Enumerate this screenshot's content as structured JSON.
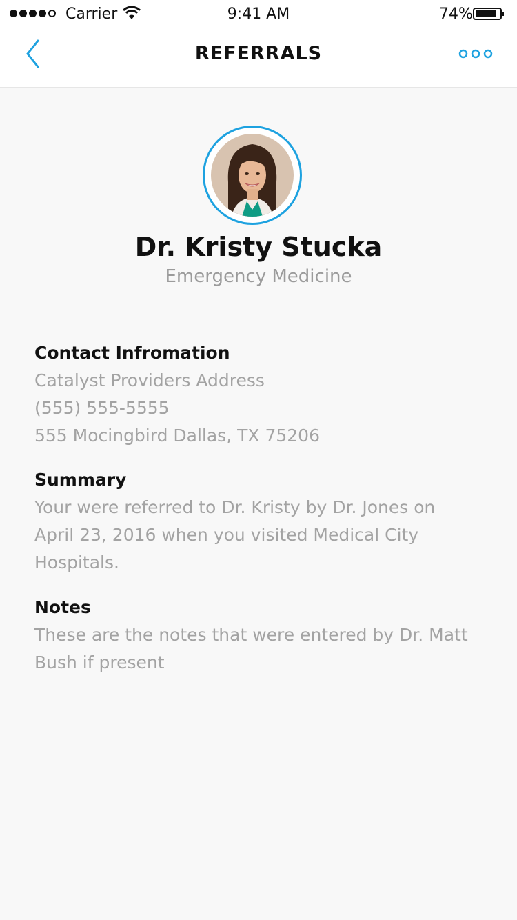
{
  "status_bar": {
    "carrier": "Carrier",
    "time": "9:41 AM",
    "battery": "74%",
    "signal_icon": "signal-dots-icon",
    "wifi_icon": "wifi-icon",
    "battery_icon": "battery-icon"
  },
  "nav": {
    "title": "REFERRALS",
    "back_icon": "chevron-left-icon",
    "more_icon": "more-dots-icon",
    "accent_color": "#1ea2e0"
  },
  "profile": {
    "name": "Dr. Kristy Stucka",
    "specialty": "Emergency Medicine",
    "avatar_icon": "doctor-avatar-photo"
  },
  "contact": {
    "heading": "Contact Infromation",
    "lines": [
      "Catalyst Providers Address",
      "(555) 555-5555",
      "555 Mocingbird Dallas, TX 75206"
    ]
  },
  "summary": {
    "heading": "Summary",
    "lines": [
      "Your were referred to Dr. Kristy by Dr. Jones on",
      "April 23, 2016 when you visited Medical City",
      "Hospitals."
    ]
  },
  "notes": {
    "heading": "Notes",
    "lines": [
      "These are the notes that were entered by Dr. Matt",
      "Bush if present"
    ]
  }
}
